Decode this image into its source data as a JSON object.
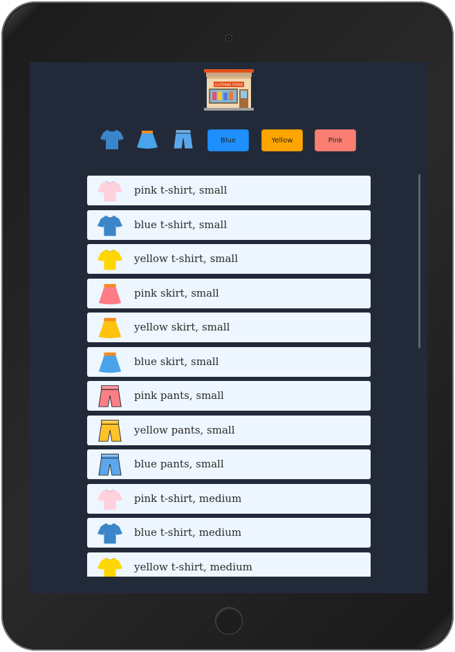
{
  "app": {
    "logo": {
      "icon": "clothing-store-icon",
      "sign_text": "CLOTHING STORE"
    }
  },
  "filters": {
    "type_icons": [
      {
        "name": "t-shirt",
        "icon": "t-shirt-icon"
      },
      {
        "name": "skirt",
        "icon": "skirt-icon"
      },
      {
        "name": "pants",
        "icon": "pants-icon"
      }
    ],
    "color_buttons": [
      {
        "label": "Blue",
        "color": "#1f8fff"
      },
      {
        "label": "Yellow",
        "color": "#ffa500"
      },
      {
        "label": "Pink",
        "color": "#fa7f72"
      }
    ]
  },
  "items": [
    {
      "label": "pink t-shirt, small",
      "type": "tshirt",
      "color": "#ffd1dc"
    },
    {
      "label": "blue t-shirt, small",
      "type": "tshirt",
      "color": "#3a86c8"
    },
    {
      "label": "yellow t-shirt, small",
      "type": "tshirt",
      "color": "#ffd700"
    },
    {
      "label": "pink skirt, small",
      "type": "skirt",
      "color": "#ff7b86"
    },
    {
      "label": "yellow skirt, small",
      "type": "skirt",
      "color": "#ffc20e"
    },
    {
      "label": "blue skirt, small",
      "type": "skirt",
      "color": "#49a3ea"
    },
    {
      "label": "pink pants, small",
      "type": "pants",
      "color": "#fa7f86"
    },
    {
      "label": "yellow pants, small",
      "type": "pants",
      "color": "#ffc229"
    },
    {
      "label": "blue pants, small",
      "type": "pants",
      "color": "#5aa7ec"
    },
    {
      "label": "pink t-shirt, medium",
      "type": "tshirt",
      "color": "#ffd1dc"
    },
    {
      "label": "blue t-shirt, medium",
      "type": "tshirt",
      "color": "#3a86c8"
    },
    {
      "label": "yellow t-shirt, medium",
      "type": "tshirt",
      "color": "#ffd700"
    }
  ]
}
